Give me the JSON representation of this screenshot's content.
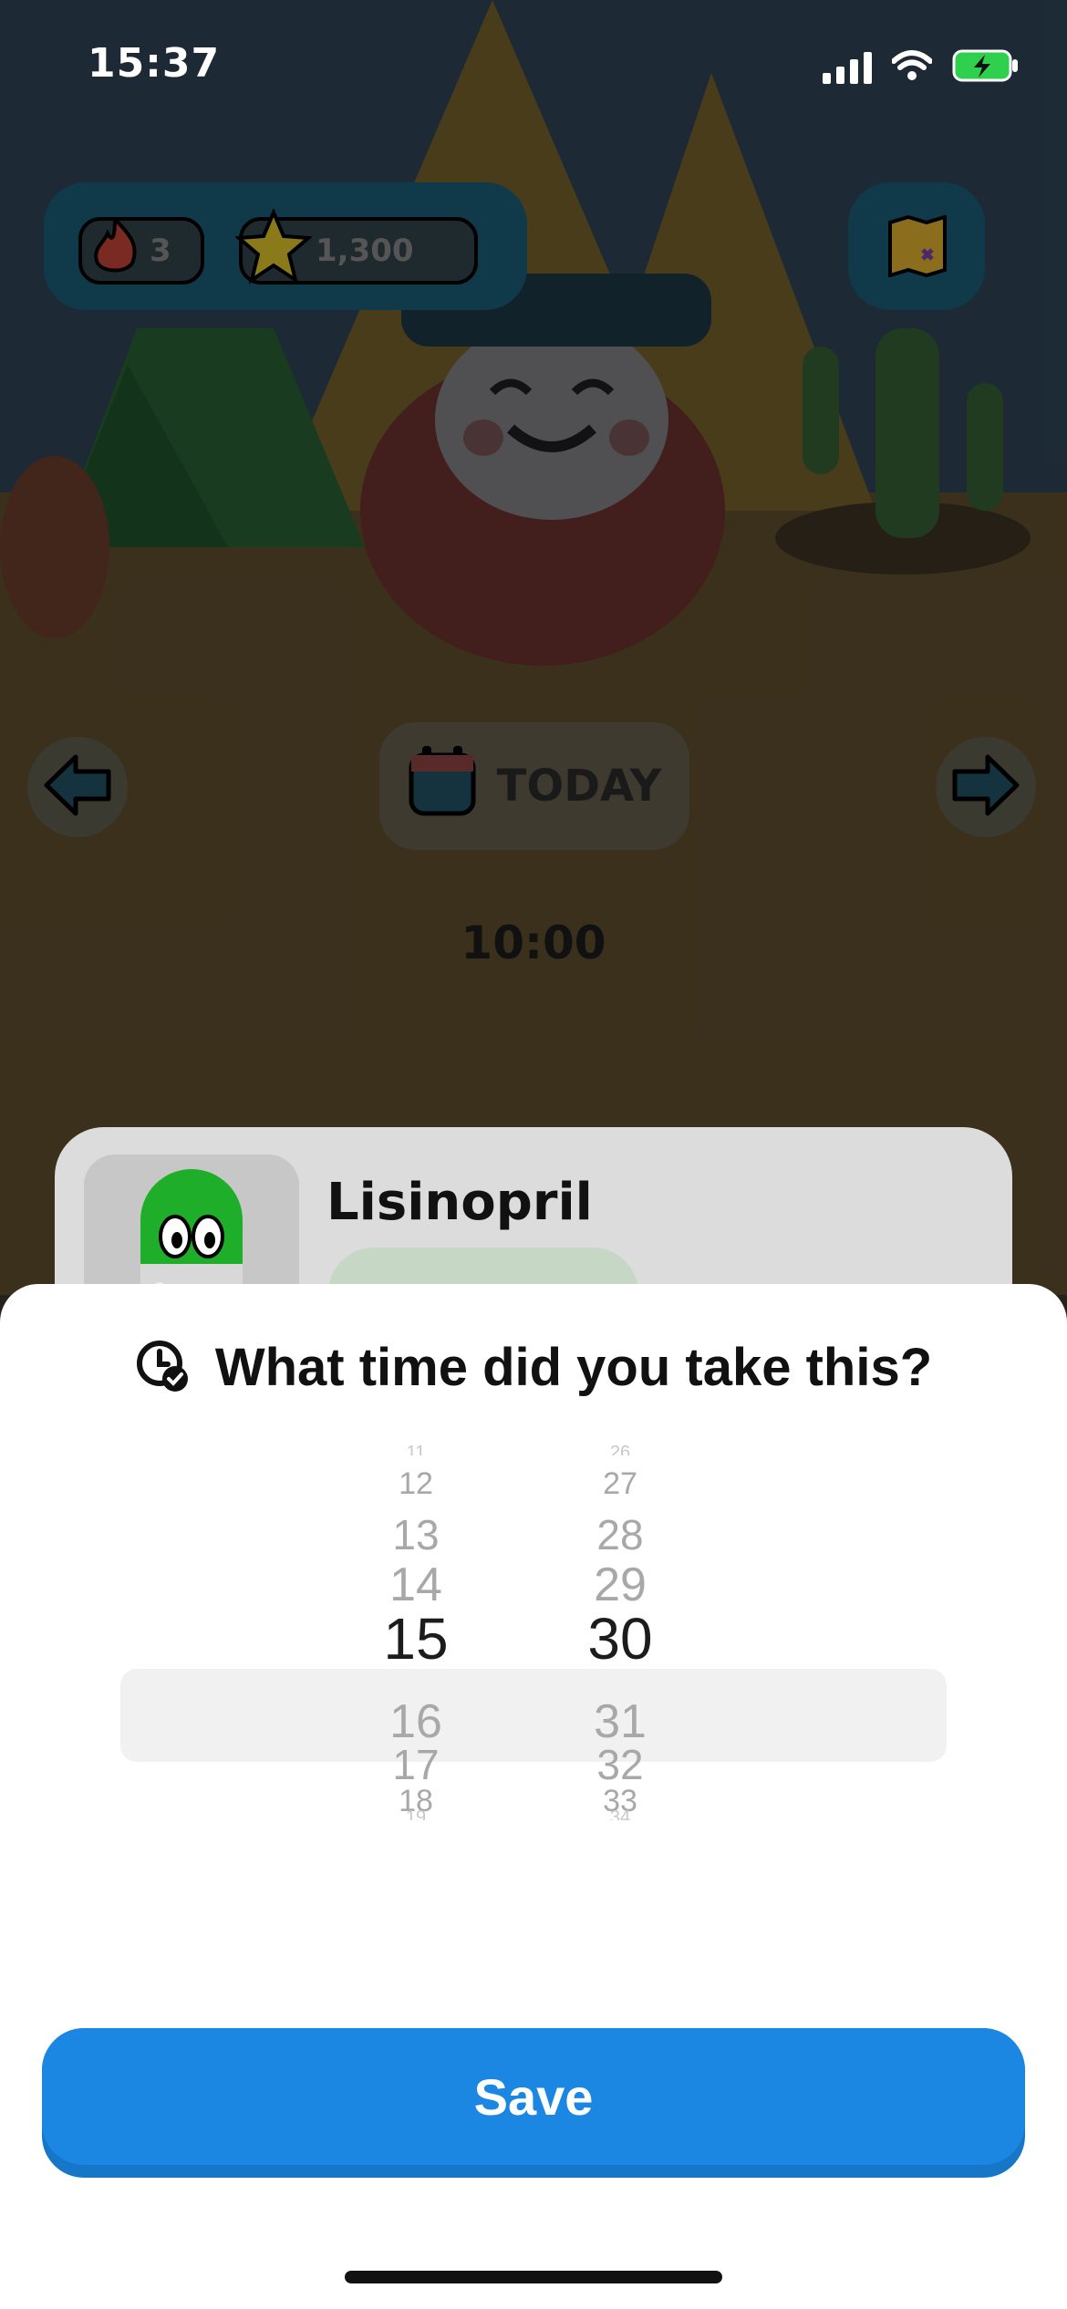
{
  "status_bar": {
    "time": "15:37"
  },
  "header": {
    "streak_count": "3",
    "stars_count": "1,300"
  },
  "day_nav": {
    "today_label": "TODAY"
  },
  "schedule": {
    "time_label": "10:00"
  },
  "medication_card": {
    "name": "Lisinopril"
  },
  "time_sheet": {
    "title": "What time did you take this?",
    "hours": [
      "11",
      "12",
      "13",
      "14",
      "15",
      "16",
      "17",
      "18",
      "19"
    ],
    "minutes": [
      "26",
      "27",
      "28",
      "29",
      "30",
      "31",
      "32",
      "33",
      "34"
    ],
    "selected_hour": "15",
    "selected_minute": "30",
    "save_label": "Save"
  },
  "colors": {
    "accent": "#1b87e3",
    "brand_green": "#1fae2a"
  }
}
